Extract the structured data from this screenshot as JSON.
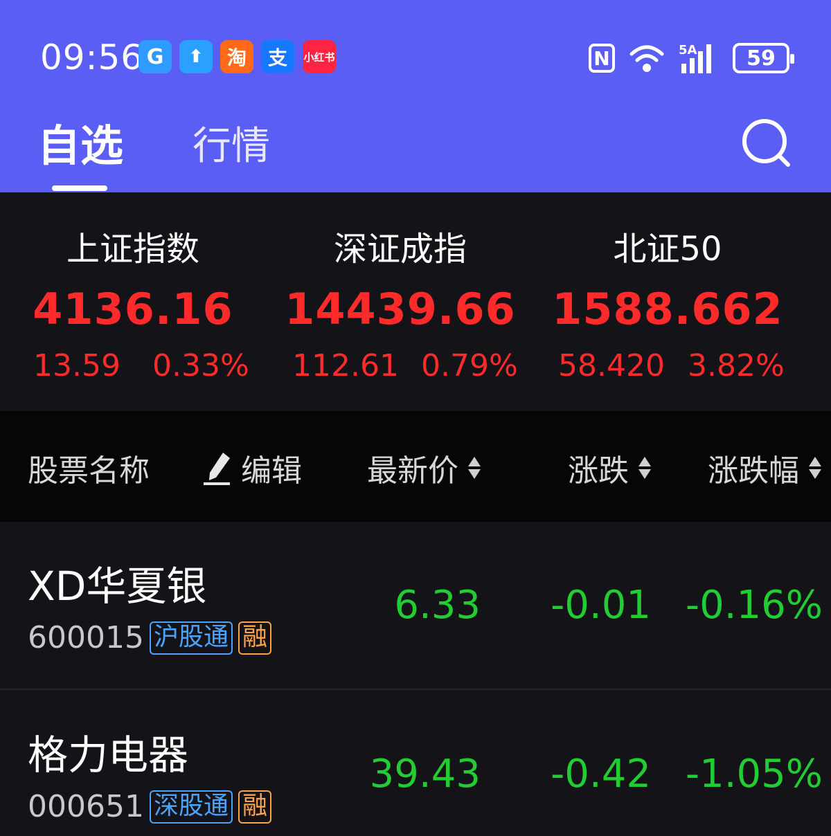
{
  "status_bar": {
    "time": "09:56",
    "app_icons": [
      {
        "name": "app-icon-1",
        "glyph": "G"
      },
      {
        "name": "app-icon-2",
        "glyph": "⬆"
      },
      {
        "name": "taobao-icon",
        "glyph": "淘"
      },
      {
        "name": "alipay-icon",
        "glyph": "支"
      },
      {
        "name": "xiaohongshu-icon",
        "glyph": "小红书"
      }
    ],
    "nfc": "N",
    "network": "5A",
    "battery": "59"
  },
  "tabs": [
    {
      "label": "自选",
      "active": true
    },
    {
      "label": "行情",
      "active": false
    }
  ],
  "indices": [
    {
      "name": "上证指数",
      "value": "4136.16",
      "change": "13.59",
      "pct": "0.33%"
    },
    {
      "name": "深证成指",
      "value": "14439.66",
      "change": "112.61",
      "pct": "0.79%"
    },
    {
      "name": "北证50",
      "value": "1588.662",
      "change": "58.420",
      "pct": "3.82%"
    }
  ],
  "columns": {
    "name": "股票名称",
    "edit": "编辑",
    "price": "最新价",
    "change": "涨跌",
    "pct": "涨跌幅"
  },
  "stocks": [
    {
      "name": "XD华夏银",
      "code": "600015",
      "connect": "沪股通",
      "margin": "融",
      "price": "6.33",
      "change": "-0.01",
      "pct": "-0.16%"
    },
    {
      "name": "格力电器",
      "code": "000651",
      "connect": "深股通",
      "margin": "融",
      "price": "39.43",
      "change": "-0.42",
      "pct": "-1.05%"
    }
  ],
  "colors": {
    "header_bg": "#5b5ef4",
    "up": "#ff2a2a",
    "down": "#22cc33",
    "connect_badge": "#4aa3ff",
    "margin_badge": "#ffa24a"
  }
}
